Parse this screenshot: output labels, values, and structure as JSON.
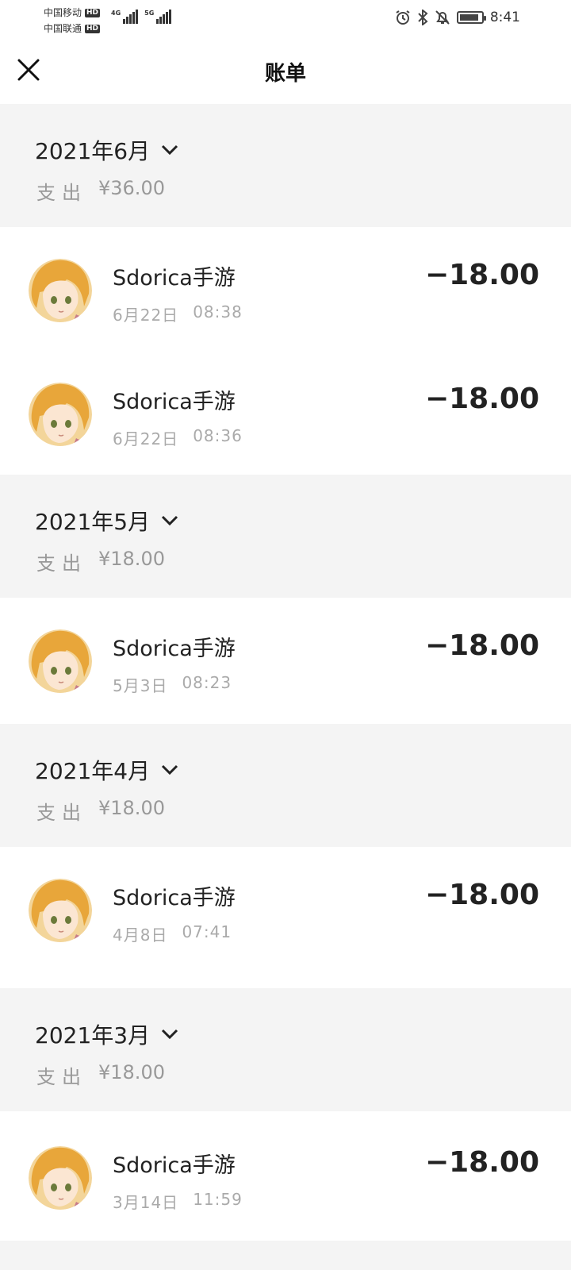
{
  "status_bar": {
    "carrier1": "中国移动",
    "carrier2": "中国联通",
    "hd_badge": "HD",
    "net1": "4G",
    "net2": "5G",
    "time": "8:41",
    "battery_fraction": 0.9
  },
  "nav": {
    "title": "账单",
    "close_icon": "close-icon"
  },
  "months": [
    {
      "title": "2021年6月",
      "expense_label": "支出",
      "expense_amount": "¥36.00",
      "transactions": [
        {
          "name": "Sdorica手游",
          "date": "6月22日",
          "time": "08:38",
          "amount": "−18.00"
        },
        {
          "name": "Sdorica手游",
          "date": "6月22日",
          "time": "08:36",
          "amount": "−18.00"
        }
      ]
    },
    {
      "title": "2021年5月",
      "expense_label": "支出",
      "expense_amount": "¥18.00",
      "transactions": [
        {
          "name": "Sdorica手游",
          "date": "5月3日",
          "time": "08:23",
          "amount": "−18.00"
        }
      ]
    },
    {
      "title": "2021年4月",
      "expense_label": "支出",
      "expense_amount": "¥18.00",
      "transactions": [
        {
          "name": "Sdorica手游",
          "date": "4月8日",
          "time": "07:41",
          "amount": "−18.00"
        }
      ]
    },
    {
      "title": "2021年3月",
      "expense_label": "支出",
      "expense_amount": "¥18.00",
      "transactions": [
        {
          "name": "Sdorica手游",
          "date": "3月14日",
          "time": "11:59",
          "amount": "−18.00"
        }
      ]
    }
  ],
  "colors": {
    "section_bg": "#f4f4f4",
    "text_primary": "#222222",
    "text_secondary": "#aaaaaa"
  }
}
